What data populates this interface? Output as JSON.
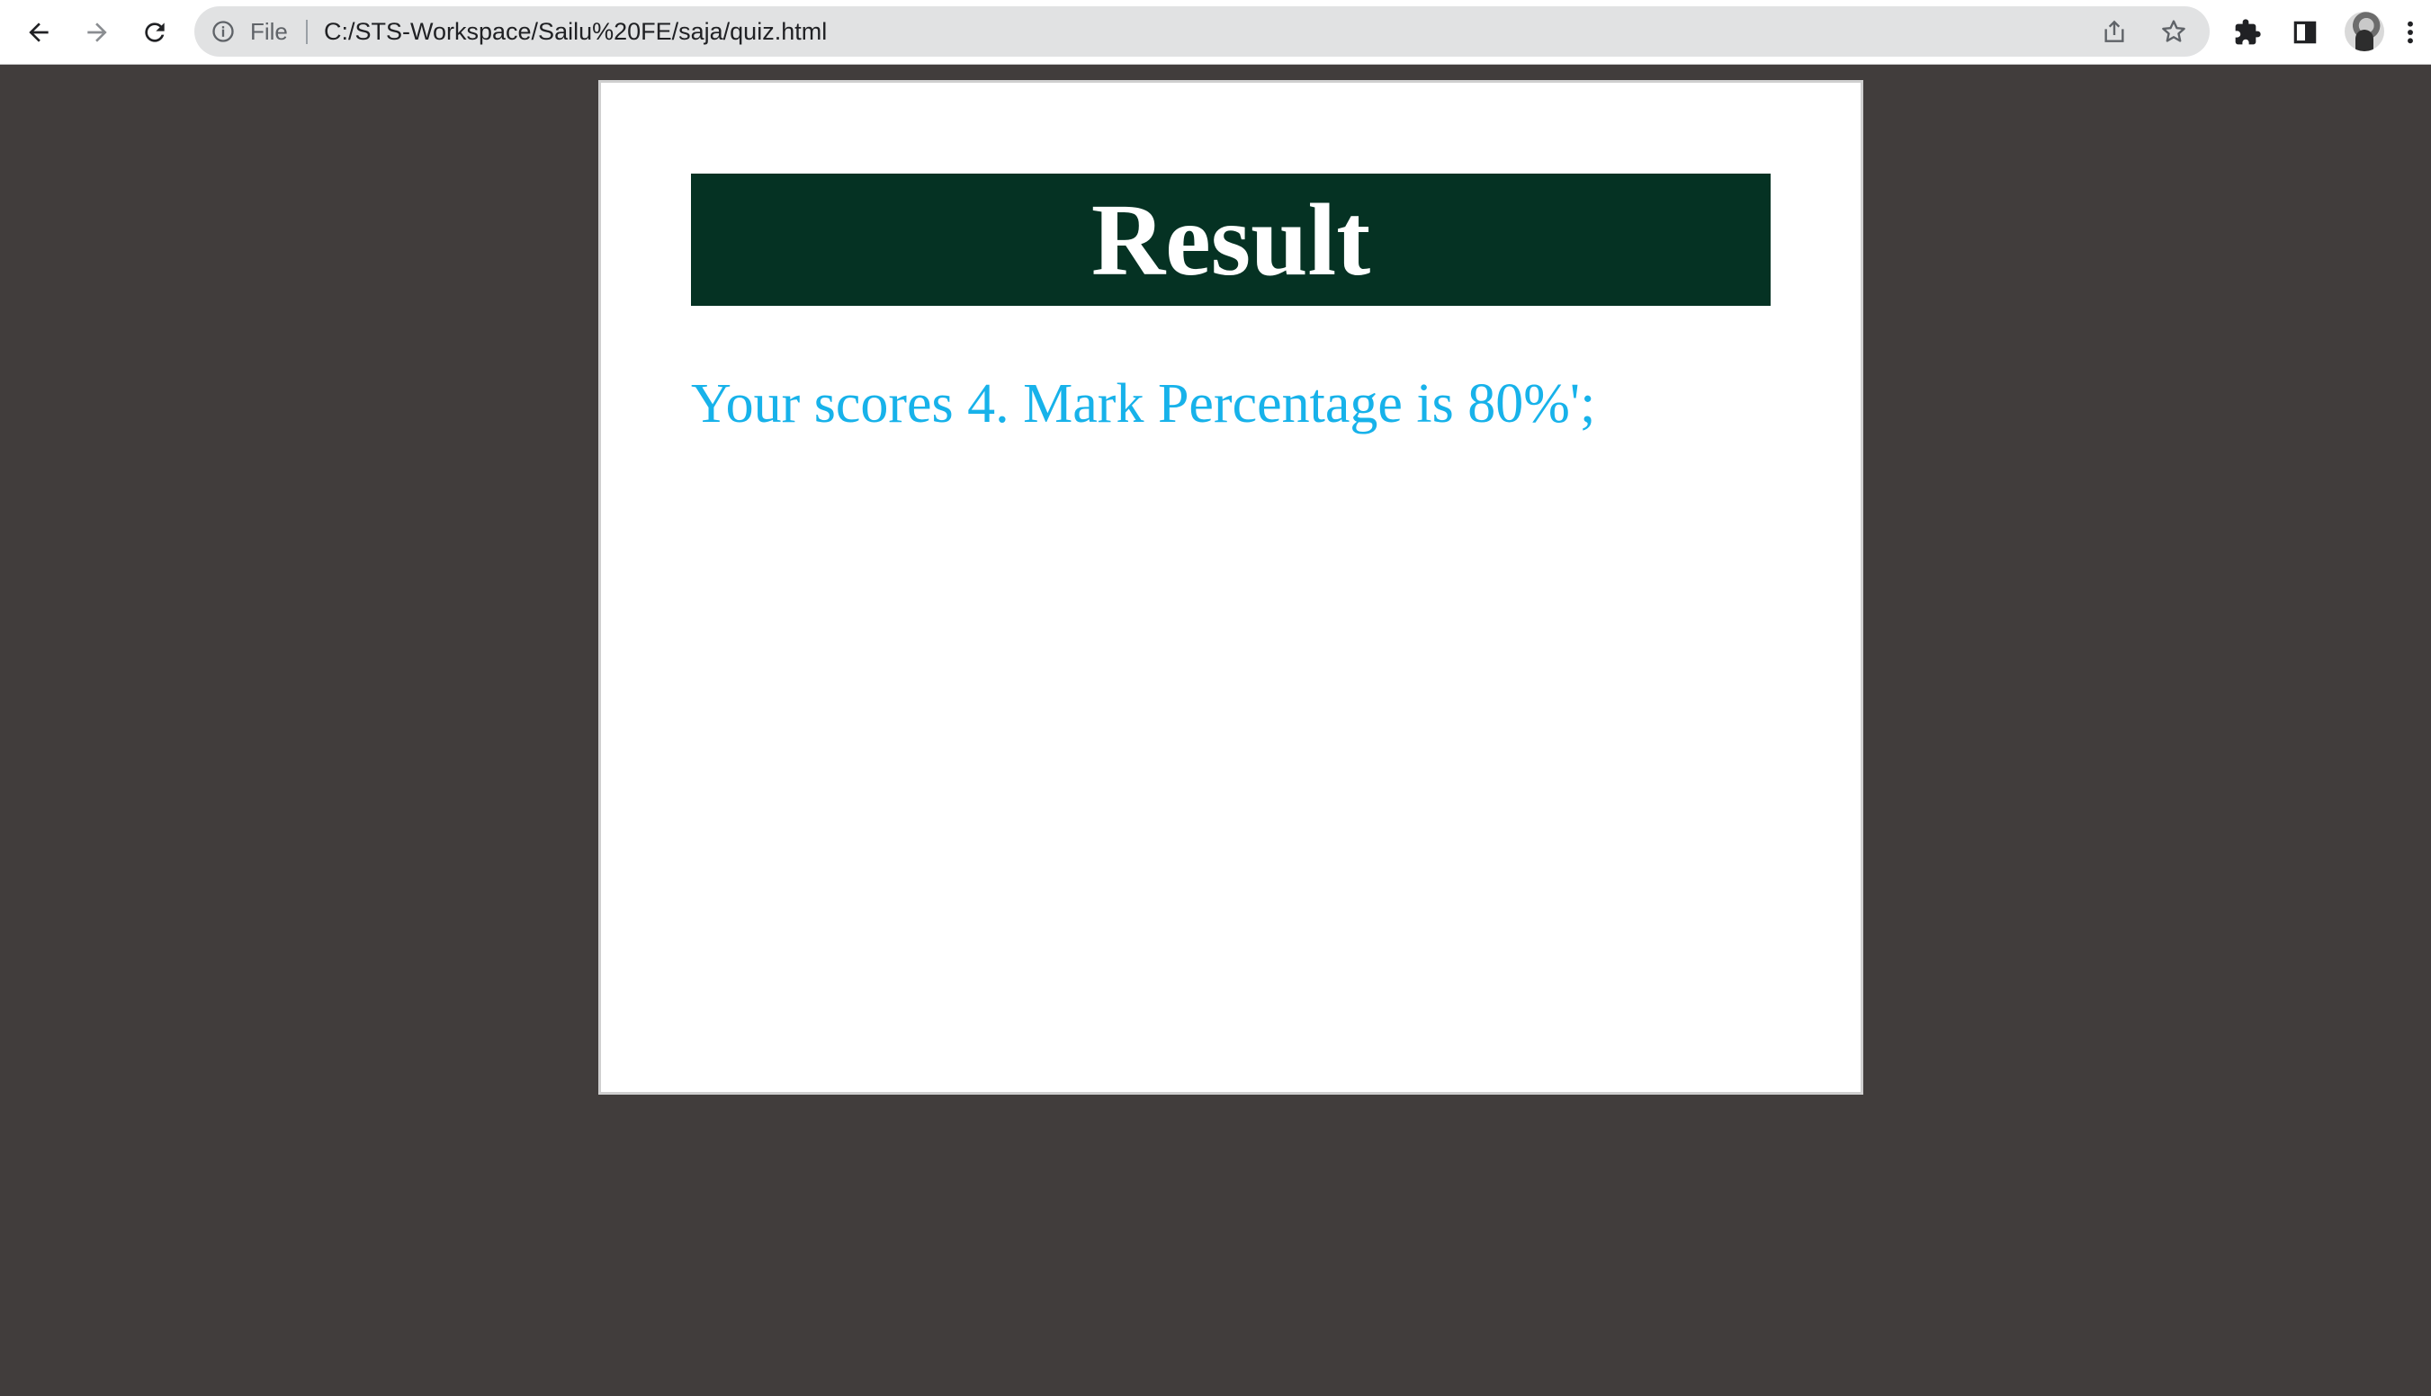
{
  "browser": {
    "back_icon": "arrow-left-icon",
    "forward_icon": "arrow-right-icon",
    "reload_icon": "reload-icon",
    "omnibox": {
      "info_icon": "info-icon",
      "scheme_label": "File",
      "url": "C:/STS-Workspace/Sailu%20FE/saja/quiz.html",
      "share_icon": "share-icon",
      "bookmark_icon": "star-icon"
    },
    "extensions_icon": "puzzle-icon",
    "side_panel_icon": "side-panel-icon",
    "profile_icon": "avatar",
    "menu_icon": "kebab-menu-icon"
  },
  "page": {
    "title": "Result",
    "score_message": "Your scores 4. Mark Percentage is 80%';",
    "colors": {
      "background": "#413d3c",
      "banner": "#053223",
      "banner_text": "#ffffff",
      "score_text": "#17b2ea"
    }
  }
}
